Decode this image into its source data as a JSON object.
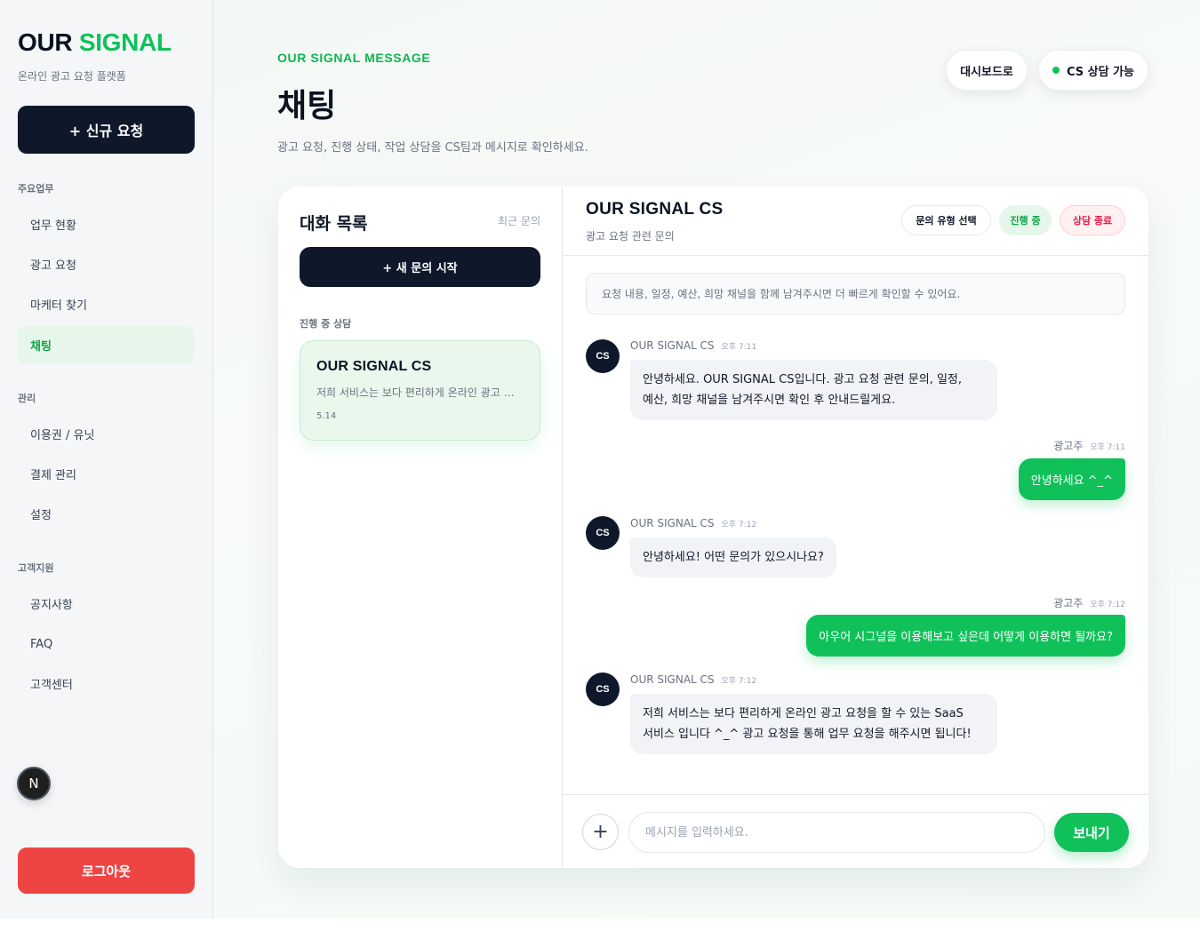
{
  "brand": {
    "name_part1": "OUR",
    "name_part2": "SIGNAL",
    "subtitle": "온라인 광고 요청 플랫폼"
  },
  "sidebar": {
    "new_request": "+ 신규 요청",
    "sections": [
      {
        "label": "주요업무",
        "items": [
          "업무 현황",
          "광고 요청",
          "마케터 찾기",
          "채팅"
        ]
      },
      {
        "label": "관리",
        "items": [
          "이용권 / 유닛",
          "결제 관리",
          "설정"
        ]
      },
      {
        "label": "고객지원",
        "items": [
          "공지사항",
          "FAQ",
          "고객센터"
        ]
      }
    ],
    "active_item": "채팅",
    "badge_letter": "N",
    "logout": "로그아웃"
  },
  "header": {
    "eyebrow": "OUR SIGNAL MESSAGE",
    "title": "채팅",
    "description": "광고 요청, 진행 상태, 작업 상담을 CS팀과 메시지로 확인하세요.",
    "dashboard_button": "대시보드로",
    "cs_status": "CS 상담 가능"
  },
  "conversation_list": {
    "title": "대화 목록",
    "recent": "최근 문의",
    "new_button": "+ 새 문의 시작",
    "section_label": "진행 중 상담",
    "items": [
      {
        "name": "OUR SIGNAL CS",
        "preview": "저희 서비스는 보다 편리하게 온라인 광고 요청을 할 수 있는 SaaS 서비스 입니다",
        "date": "5.14"
      }
    ]
  },
  "chat": {
    "name": "OUR SIGNAL CS",
    "subtitle": "광고 요청 관련 문의",
    "buttons": {
      "type": "문의 유형 선택",
      "progress": "진행 중",
      "end": "상담 종료"
    },
    "notice": "요청 내용, 일정, 예산, 희망 채널을 함께 남겨주시면 더 빠르게 확인할 수 있어요.",
    "avatar_label": "CS",
    "messages": [
      {
        "from": "cs",
        "sender": "OUR SIGNAL CS",
        "time": "오후 7:11",
        "lines": [
          "안녕하세요. OUR SIGNAL CS입니다. 광고 요청 관련 문의, 일정,",
          "예산, 희망 채널을 남겨주시면 확인 후 안내드릴게요."
        ]
      },
      {
        "from": "user",
        "sender": "광고주",
        "time": "오후 7:11",
        "text": "안녕하세요 ^_^"
      },
      {
        "from": "cs",
        "sender": "OUR SIGNAL CS",
        "time": "오후 7:12",
        "lines": [
          "안녕하세요! 어떤 문의가 있으시나요?"
        ]
      },
      {
        "from": "user",
        "sender": "광고주",
        "time": "오후 7:12",
        "text": "아우어 시그널을 이용해보고 싶은데 어떻게 이용하면 될까요?"
      },
      {
        "from": "cs",
        "sender": "OUR SIGNAL CS",
        "time": "오후 7:12",
        "lines": [
          "저희 서비스는 보다 편리하게 온라인 광고 요청을 할 수 있는 SaaS",
          "서비스 입니다 ^_^ 광고 요청을 통해 업무 요청을 해주시면 됩니다!"
        ]
      }
    ],
    "composer": {
      "placeholder": "메시지를 입력하세요.",
      "value": "",
      "send": "보내기"
    }
  },
  "colors": {
    "accent": "#10c15a",
    "dark": "#0f172a",
    "danger": "#ef4444"
  }
}
